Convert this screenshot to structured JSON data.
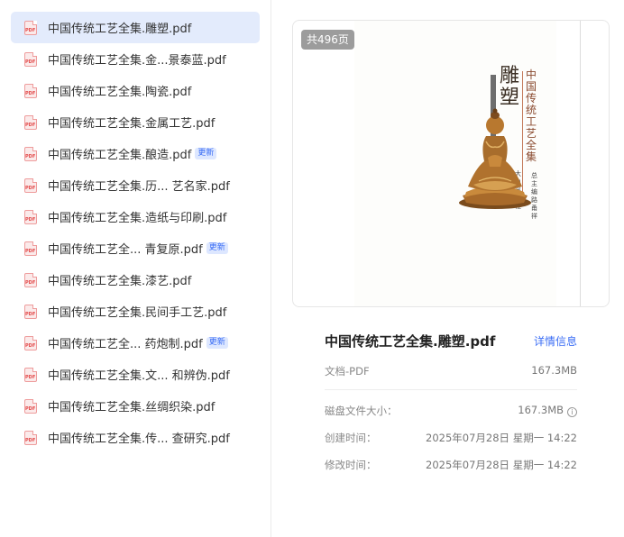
{
  "files": [
    {
      "name": "中国传统工艺全集.雕塑.pdf",
      "selected": true,
      "badge": ""
    },
    {
      "name": "中国传统工艺全集.金...景泰蓝.pdf",
      "selected": false,
      "badge": ""
    },
    {
      "name": "中国传统工艺全集.陶瓷.pdf",
      "selected": false,
      "badge": ""
    },
    {
      "name": "中国传统工艺全集.金属工艺.pdf",
      "selected": false,
      "badge": ""
    },
    {
      "name": "中国传统工艺全集.酿造.pdf",
      "selected": false,
      "badge": "更新"
    },
    {
      "name": "中国传统工艺全集.历... 艺名家.pdf",
      "selected": false,
      "badge": ""
    },
    {
      "name": "中国传统工艺全集.造纸与印刷.pdf",
      "selected": false,
      "badge": ""
    },
    {
      "name": "中国传统工艺全... 青复原.pdf",
      "selected": false,
      "badge": "更新"
    },
    {
      "name": "中国传统工艺全集.漆艺.pdf",
      "selected": false,
      "badge": ""
    },
    {
      "name": "中国传统工艺全集.民间手工艺.pdf",
      "selected": false,
      "badge": ""
    },
    {
      "name": "中国传统工艺全... 药炮制.pdf",
      "selected": false,
      "badge": "更新"
    },
    {
      "name": "中国传统工艺全集.文... 和辨伪.pdf",
      "selected": false,
      "badge": ""
    },
    {
      "name": "中国传统工艺全集.丝绸织染.pdf",
      "selected": false,
      "badge": ""
    },
    {
      "name": "中国传统工艺全集.传... 查研究.pdf",
      "selected": false,
      "badge": ""
    }
  ],
  "preview": {
    "page_count": "共496页",
    "cover_title": "雕塑",
    "cover_series": "中国传统工艺全集",
    "cover_editor": "总主编 路甬祥",
    "cover_publisher": "大象出版社"
  },
  "detail": {
    "title": "中国传统工艺全集.雕塑.pdf",
    "link": "详情信息",
    "type_label": "文档-PDF",
    "size": "167.3MB",
    "disk_label": "磁盘文件大小：",
    "disk_value": "167.3MB",
    "created_label": "创建时间：",
    "created_value": "2025年07月28日 星期一 14:22",
    "modified_label": "修改时间：",
    "modified_value": "2025年07月28日 星期一 14:22"
  }
}
